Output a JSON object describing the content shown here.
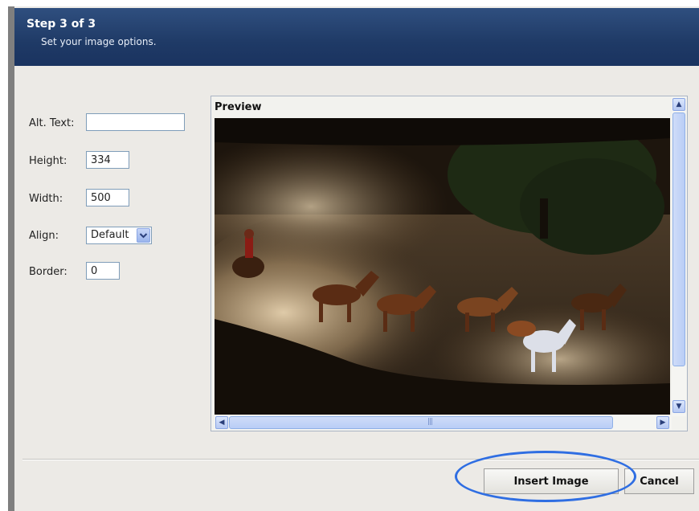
{
  "header": {
    "step": "Step 3 of 3",
    "subtitle": "Set your image options."
  },
  "form": {
    "alt_text": {
      "label": "Alt. Text:",
      "value": ""
    },
    "height": {
      "label": "Height:",
      "value": "334"
    },
    "width": {
      "label": "Width:",
      "value": "500"
    },
    "align": {
      "label": "Align:",
      "value": "Default"
    },
    "border": {
      "label": "Border:",
      "value": "0"
    }
  },
  "preview": {
    "label": "Preview",
    "image": "horses-running-in-dust-photo"
  },
  "scrollbar": {
    "grip": "|||"
  },
  "buttons": {
    "insert": "Insert Image",
    "cancel": "Cancel"
  },
  "colors": {
    "header": "#1f3a66",
    "highlight": "#2f6ee2"
  }
}
